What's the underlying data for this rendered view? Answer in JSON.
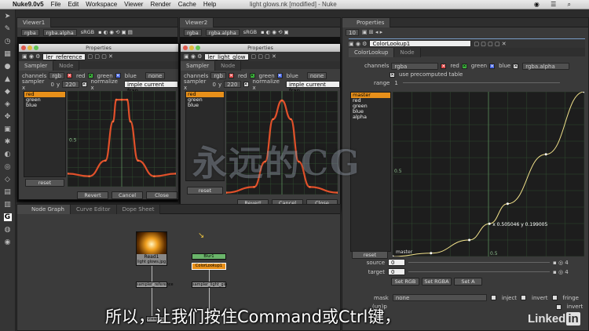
{
  "menubar": {
    "app": "Nuke9.0v5",
    "items": [
      "File",
      "Edit",
      "Workspace",
      "Viewer",
      "Render",
      "Cache",
      "Help"
    ],
    "title": "light glows.nk [modified] - Nuke"
  },
  "viewer1": {
    "tab": "Viewer1",
    "channels": "rgba",
    "alpha": "rgba.alpha",
    "colorspace": "sRGB"
  },
  "viewer2": {
    "tab": "Viewer2",
    "channels": "rgba",
    "alpha": "rgba.alpha",
    "colorspace": "sRGB"
  },
  "float1": {
    "title": "Properties",
    "name": "ler_reference",
    "tabs": [
      "Sampler",
      "Node"
    ],
    "channels_label": "channels",
    "channels": "rgb",
    "red": "red",
    "green": "green",
    "blue": "blue",
    "none": "none",
    "sampler_label": "sampler x",
    "sampler_x": "0",
    "sampler_y_label": "y",
    "sampler_y": "220",
    "normalize": "normalize x",
    "mode": "imple current fran",
    "list": [
      "red",
      "green",
      "blue"
    ],
    "reset": "reset",
    "buttons": [
      "Revert",
      "Cancel",
      "Close"
    ],
    "ylabel_a": "0.5",
    "ylabel_b": "1"
  },
  "float2": {
    "title": "Properties",
    "name": "ler_light_glow",
    "tabs": [
      "Sampler",
      "Node"
    ],
    "channels_label": "channels",
    "channels": "rgb",
    "red": "red",
    "green": "green",
    "blue": "blue",
    "none": "none",
    "sampler_label": "sampler x",
    "sampler_x": "0",
    "sampler_y_label": "y",
    "sampler_y": "220",
    "normalize": "normalize x",
    "mode": "imple current fran",
    "list": [
      "red",
      "green",
      "blue"
    ],
    "reset": "reset",
    "buttons": [
      "Revert",
      "Cancel",
      "Close"
    ]
  },
  "nodegraph": {
    "tabs": [
      "Node Graph",
      "Curve Editor",
      "Dope Sheet"
    ],
    "read_label": "Read1",
    "read_file": "light glows.jpg",
    "lookup_label": "ColorLookup1",
    "n1": "sampler_reference",
    "n2": "sampler_light_glo",
    "n3": "Viewer1",
    "n4": "Blur1"
  },
  "properties": {
    "tab": "Properties",
    "count": "10",
    "node": "ColorLookup1",
    "tabs": [
      "ColorLookup",
      "Node"
    ],
    "channels_label": "channels",
    "channels": "rgba",
    "red": "red",
    "green": "green",
    "blue": "blue",
    "alpha_channel": "rgba.alpha",
    "precomputed": "use precomputed table",
    "range_label": "range",
    "range": "1",
    "curves": [
      "master",
      "red",
      "green",
      "blue",
      "alpha"
    ],
    "curve_readout": "x 0.505046 y 0.199005",
    "curve_name": "master",
    "reset": "reset",
    "source_label": "source",
    "source_val": "0",
    "target_label": "target",
    "target_val": "0",
    "set_buttons": [
      "Set RGB",
      "Set RGBA",
      "Set A"
    ],
    "mask_label": "mask",
    "mask_val": "none",
    "inject": "inject",
    "invert": "invert",
    "fringe": "fringe",
    "unpremult_label": "(un)p",
    "invert2": "invert",
    "xtick": "0.5",
    "ytick": "0.5"
  },
  "overlay": {
    "watermark": "永远的CG",
    "subtitle": "所以，让我们按住Command或Ctrl键，",
    "brand": "Linked",
    "brand_in": "in"
  },
  "chart_data": [
    {
      "type": "line",
      "title": "",
      "series": [
        {
          "name": "red",
          "x": [
            0,
            0.2,
            0.35,
            0.42,
            0.45,
            0.5,
            0.55,
            0.58,
            0.65,
            0.8,
            1
          ],
          "y": [
            0.15,
            0.12,
            0.3,
            0.75,
            1,
            1,
            1,
            0.75,
            0.3,
            0.12,
            0.15
          ]
        }
      ],
      "xlim": [
        0,
        1
      ],
      "ylim": [
        0,
        1.1
      ],
      "grid": true
    },
    {
      "type": "line",
      "title": "",
      "series": [
        {
          "name": "red",
          "x": [
            0,
            0.25,
            0.35,
            0.42,
            0.5,
            0.58,
            0.65,
            0.75,
            1
          ],
          "y": [
            0.02,
            0.08,
            0.35,
            0.8,
            1,
            0.8,
            0.35,
            0.08,
            0.02
          ]
        }
      ],
      "xlim": [
        0,
        1
      ],
      "ylim": [
        0,
        1.1
      ],
      "grid": true
    },
    {
      "type": "line",
      "title": "",
      "series": [
        {
          "name": "master",
          "x": [
            0,
            0.2,
            0.4,
            0.505,
            0.6,
            0.8,
            1
          ],
          "y": [
            0,
            0.02,
            0.1,
            0.199,
            0.32,
            0.62,
            1
          ]
        }
      ],
      "xlim": [
        0,
        1
      ],
      "ylim": [
        0,
        1
      ],
      "grid": true
    }
  ]
}
